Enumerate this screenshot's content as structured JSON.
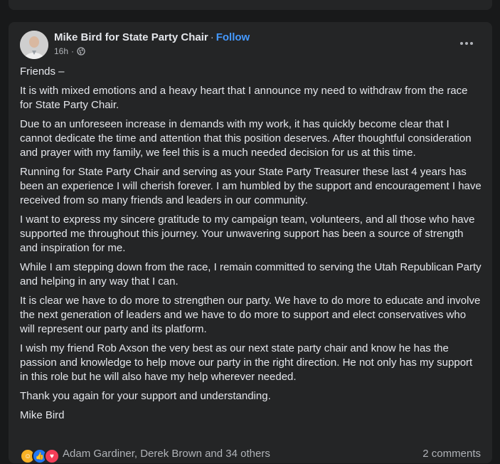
{
  "post": {
    "author": "Mike Bird for State Party Chair",
    "separator": "·",
    "follow_label": "Follow",
    "time": "16h",
    "time_separator": "·",
    "privacy_icon": "globe-icon",
    "more_icon": "more-options-icon",
    "paragraphs": [
      "Friends –",
      "It is with mixed emotions and a heavy heart that I announce my need to withdraw from the race for State Party Chair.",
      "Due to an unforeseen increase in demands with my work, it has quickly become clear that I cannot dedicate the time and attention that this position deserves. After thoughtful consideration and prayer with my family, we feel this is a much needed decision for us at this time.",
      "Running for State Party Chair and serving as your State Party Treasurer these last 4 years has been an experience I will cherish forever. I am humbled by the support and encouragement I have received from so many friends and leaders in our community.",
      "I want to express my sincere gratitude to my campaign team, volunteers, and all those who have supported me throughout this journey. Your unwavering support has been a source of strength and inspiration for me.",
      "While I am stepping down from the race, I remain committed to serving the Utah Republican Party and helping in any way that I can.",
      "It is clear we have to do more to strengthen our party. We have to do more to educate and involve the next generation of leaders and we have to do more to support and elect conservatives who will represent our party and its platform.",
      "I wish my friend Rob Axson the very best as our next state party chair and know he has the passion and knowledge to help move our party in the right direction. He not only has my support in this role but he will also have my help wherever needed.",
      "Thank you again for your support and understanding.",
      "Mike Bird"
    ],
    "reactions": {
      "icons": [
        "care-reaction-icon",
        "like-reaction-icon",
        "love-reaction-icon"
      ],
      "names": "Adam Gardiner, Derek Brown and 34 others",
      "comments": "2 comments"
    }
  },
  "colors": {
    "background": "#18191a",
    "card": "#242526",
    "text": "#e4e6eb",
    "secondary_text": "#b0b3b8",
    "link": "#4599ff"
  }
}
